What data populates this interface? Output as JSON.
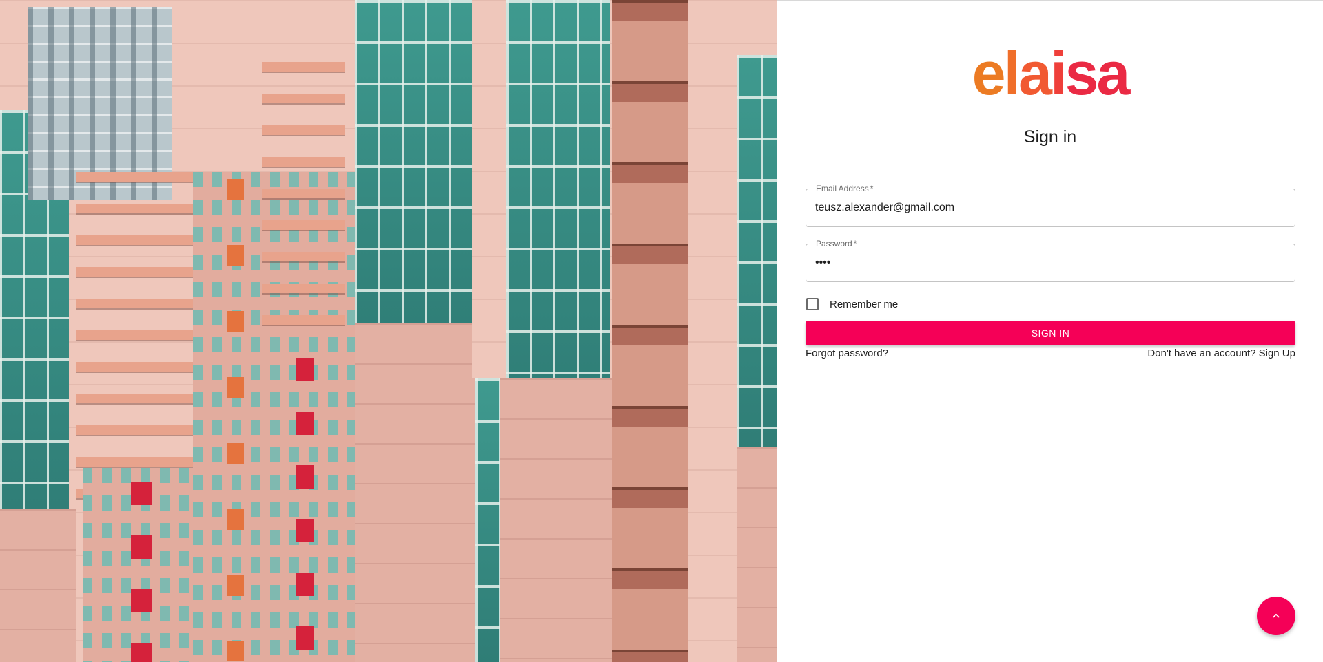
{
  "hero": {
    "image_name": "building-facade-image"
  },
  "brand": {
    "logo_letters": [
      "e",
      "l",
      "a",
      "i",
      "s",
      "a"
    ],
    "colors": {
      "gradient_start": "#ec7b23",
      "gradient_end": "#ea2a44"
    }
  },
  "form": {
    "title": "Sign in",
    "email": {
      "label": "Email Address",
      "required_mark": "*",
      "value": "teusz.alexander@gmail.com"
    },
    "password": {
      "label": "Password",
      "required_mark": "*",
      "value": "••••"
    },
    "remember_label": "Remember me",
    "remember_checked": false,
    "submit_label": "SIGN IN",
    "forgot_link": "Forgot password?",
    "signup_link": "Don't have an account? Sign Up"
  },
  "fab": {
    "icon": "chevron-up-icon"
  },
  "colors": {
    "accent": "#f50057",
    "text": "#1f1f1f",
    "border": "#c4c4c4"
  }
}
